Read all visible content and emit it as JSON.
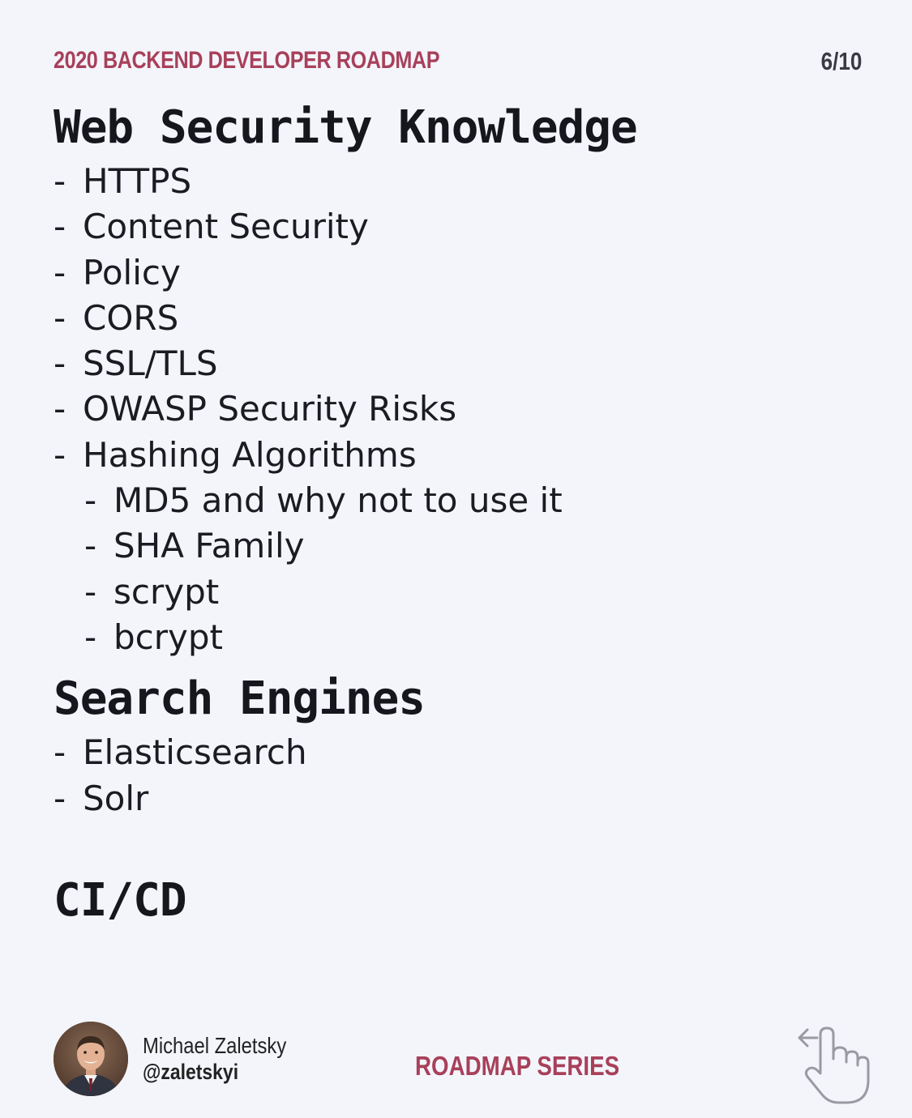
{
  "header": {
    "series_title": "2020 BACKEND DEVELOPER ROADMAP",
    "page_number": "6/10"
  },
  "sections": {
    "web_security": {
      "title": "Web Security Knowledge",
      "items": [
        "HTTPS",
        "Content Security",
        "Policy",
        "CORS",
        "SSL/TLS",
        "OWASP Security Risks",
        "Hashing Algorithms"
      ],
      "subitems": [
        "MD5 and why not to use it",
        "SHA Family",
        "scrypt",
        "bcrypt"
      ]
    },
    "search_engines": {
      "title": "Search Engines",
      "items": [
        "Elasticsearch",
        "Solr"
      ]
    },
    "ci_cd": {
      "title": "CI/CD"
    }
  },
  "bullet": "-",
  "footer": {
    "author_name": "Michael Zaletsky",
    "author_handle": "@zaletskyi",
    "series_label": "ROADMAP SERIES",
    "avatar_icon": "avatar-photo",
    "swipe_icon": "hand-swipe-left-icon"
  },
  "colors": {
    "accent": "#a8405a",
    "background": "#f3f5fb",
    "text": "#16161d"
  }
}
